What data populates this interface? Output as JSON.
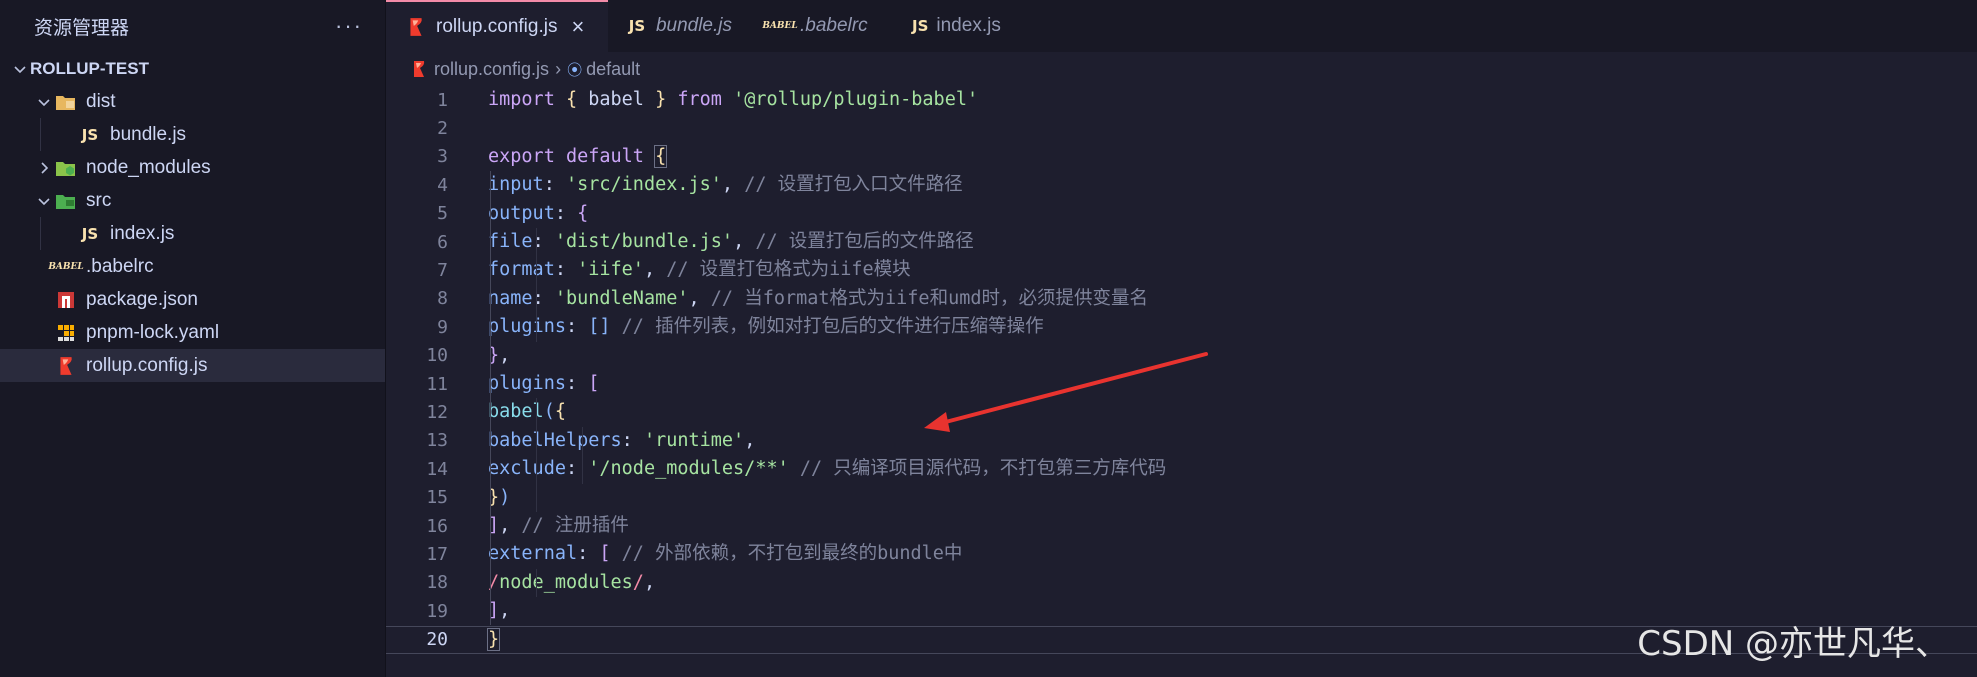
{
  "sidebar": {
    "title": "资源管理器",
    "more": "···",
    "items": [
      {
        "label": "ROLLUP-TEST",
        "indent": 0,
        "chevron": "down",
        "icon": "",
        "root": true
      },
      {
        "label": "dist",
        "indent": 1,
        "chevron": "down",
        "icon": "folder-dist-icon"
      },
      {
        "label": "bundle.js",
        "indent": 2,
        "chevron": "",
        "icon": "js-icon"
      },
      {
        "label": "node_modules",
        "indent": 1,
        "chevron": "right",
        "icon": "folder-node-icon"
      },
      {
        "label": "src",
        "indent": 1,
        "chevron": "down",
        "icon": "folder-src-icon"
      },
      {
        "label": "index.js",
        "indent": 2,
        "chevron": "",
        "icon": "js-icon"
      },
      {
        "label": ".babelrc",
        "indent": 1,
        "chevron": "",
        "icon": "babel-icon"
      },
      {
        "label": "package.json",
        "indent": 1,
        "chevron": "",
        "icon": "npm-icon"
      },
      {
        "label": "pnpm-lock.yaml",
        "indent": 1,
        "chevron": "",
        "icon": "pnpm-icon"
      },
      {
        "label": "rollup.config.js",
        "indent": 1,
        "chevron": "",
        "icon": "rollup-icon",
        "selected": true
      }
    ]
  },
  "tabs": [
    {
      "label": "rollup.config.js",
      "icon": "rollup-icon",
      "active": true,
      "close": "×"
    },
    {
      "label": "bundle.js",
      "icon": "js-icon"
    },
    {
      "label": ".babelrc",
      "icon": "babel-icon"
    },
    {
      "label": "index.js",
      "icon": "js-icon"
    }
  ],
  "breadcrumb": {
    "file": "rollup.config.js",
    "symbol": "default"
  },
  "icon_text": {
    "js": "JS",
    "babel": "BABEL"
  },
  "editor": {
    "current_line": 20,
    "line_numbers": [
      "1",
      "2",
      "3",
      "4",
      "5",
      "6",
      "7",
      "8",
      "9",
      "10",
      "11",
      "12",
      "13",
      "14",
      "15",
      "16",
      "17",
      "18",
      "19",
      "20"
    ]
  },
  "watermark": "CSDN @亦世凡华、",
  "colors": {
    "accent": "#f38ba8",
    "annotation_arrow": "#e8332f"
  }
}
